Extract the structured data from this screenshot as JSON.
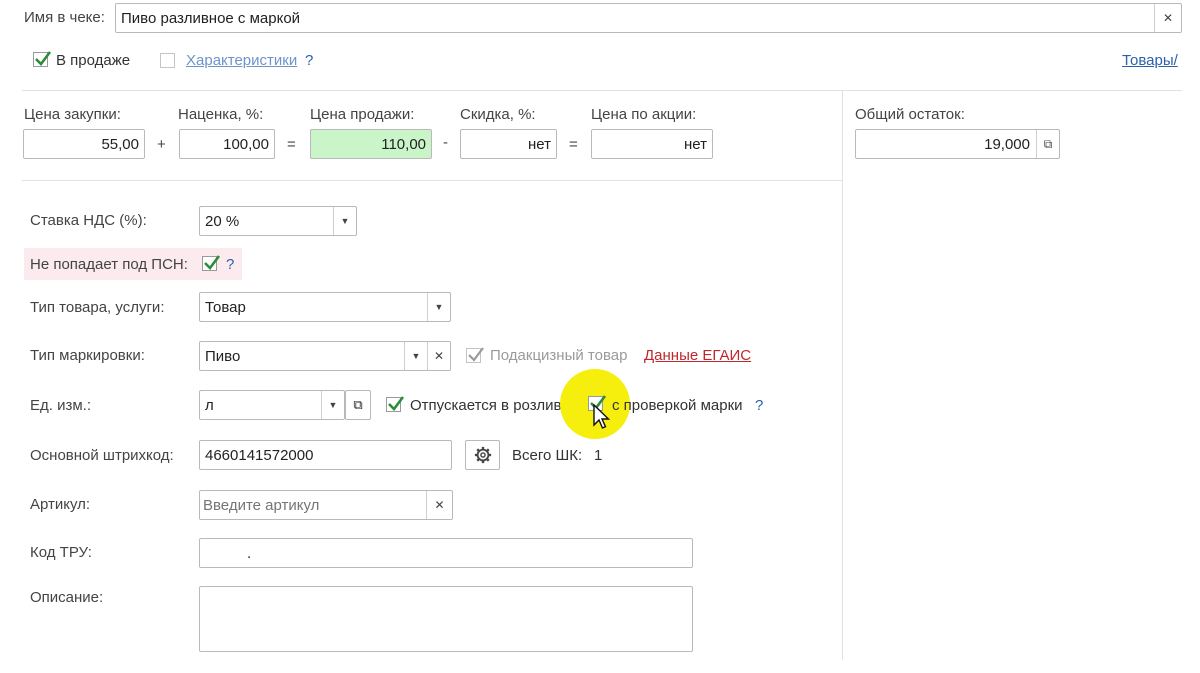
{
  "receipt_name": {
    "label": "Имя в чеке:",
    "value": "Пиво разливное с маркой"
  },
  "flags": {
    "on_sale_label": "В продаже",
    "characteristics_label": "Характеристики",
    "help_mark": "?",
    "goods_link": "Товары/"
  },
  "prices": {
    "purchase": {
      "label": "Цена закупки:",
      "value": "55,00"
    },
    "markup": {
      "label": "Наценка, %:",
      "value": "100,00"
    },
    "sale": {
      "label": "Цена продажи:",
      "value": "110,00"
    },
    "discount": {
      "label": "Скидка, %:",
      "value": "нет"
    },
    "promo": {
      "label": "Цена по акции:",
      "value": "нет"
    },
    "ops": {
      "plus": "+",
      "eq1": "=",
      "minus": "-",
      "eq2": "="
    }
  },
  "stock": {
    "label": "Общий остаток:",
    "value": "19,000"
  },
  "vat": {
    "label": "Ставка НДС (%):",
    "value": "20 %"
  },
  "psn": {
    "label": "Не попадает под ПСН:",
    "help": "?"
  },
  "item_type": {
    "label": "Тип товара, услуги:",
    "value": "Товар"
  },
  "marking": {
    "label": "Тип маркировки:",
    "value": "Пиво",
    "excise_label": "Подакцизный товар",
    "egais_link": "Данные ЕГАИС"
  },
  "unit": {
    "label": "Ед. изм.:",
    "value": "л",
    "draft_label": "Отпускается в розлив",
    "check_mark_label": "с проверкой марки",
    "help": "?"
  },
  "barcode": {
    "label": "Основной штрихкод:",
    "value": "4660141572000",
    "total_label": "Всего ШК:",
    "total_value": "1"
  },
  "article": {
    "label": "Артикул:",
    "placeholder": "Введите артикул"
  },
  "tru": {
    "label": "Код ТРУ:",
    "value": "."
  },
  "description": {
    "label": "Описание:",
    "value": ""
  },
  "colors": {
    "accent_green": "#2e8b3a",
    "sale_bg": "#c9f5c9",
    "psn_bg": "#fbeaee",
    "highlight": "#f5ee00",
    "link_red": "#c0272d"
  }
}
